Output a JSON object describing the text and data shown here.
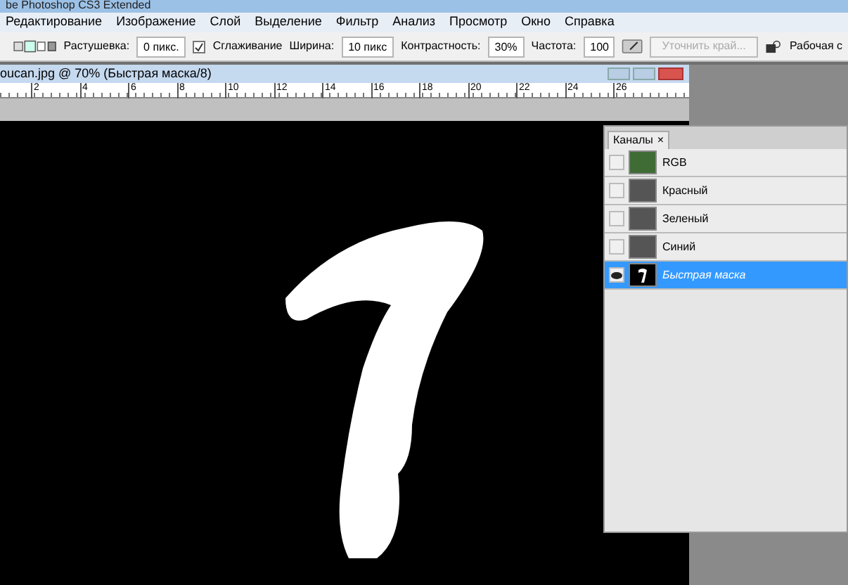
{
  "window": {
    "title": "be Photoshop CS3 Extended"
  },
  "menu": [
    "Редактирование",
    "Изображение",
    "Слой",
    "Выделение",
    "Фильтр",
    "Анализ",
    "Просмотр",
    "Окно",
    "Справка"
  ],
  "options_bar": {
    "feather_label": "Растушевка:",
    "feather_value": "0 пикс.",
    "antialias": {
      "label": "Сглаживание",
      "checked": true
    },
    "width_label": "Ширина:",
    "width_value": "10 пикс",
    "contrast_label": "Контрастность:",
    "contrast_value": "30%",
    "frequency_label": "Частота:",
    "frequency_value": "100",
    "refine_button": {
      "label": "Уточнить край...",
      "disabled": true
    },
    "workspace_label": "Рабочая с"
  },
  "document": {
    "title": "oucan.jpg @ 70% (Быстрая маска/8)",
    "ruler": [
      "2",
      "4",
      "6",
      "8",
      "10",
      "12",
      "14",
      "16",
      "18",
      "20",
      "22",
      "24",
      "26"
    ]
  },
  "channels_panel": {
    "tab": "Каналы",
    "close": "×",
    "channels": [
      {
        "name": "RGB",
        "visible": false,
        "selected": false,
        "kind": "color"
      },
      {
        "name": "Красный",
        "visible": false,
        "selected": false,
        "kind": "gray"
      },
      {
        "name": "Зеленый",
        "visible": false,
        "selected": false,
        "kind": "gray"
      },
      {
        "name": "Синий",
        "visible": false,
        "selected": false,
        "kind": "gray"
      },
      {
        "name": "Быстрая маска",
        "visible": true,
        "selected": true,
        "kind": "mask"
      }
    ]
  }
}
